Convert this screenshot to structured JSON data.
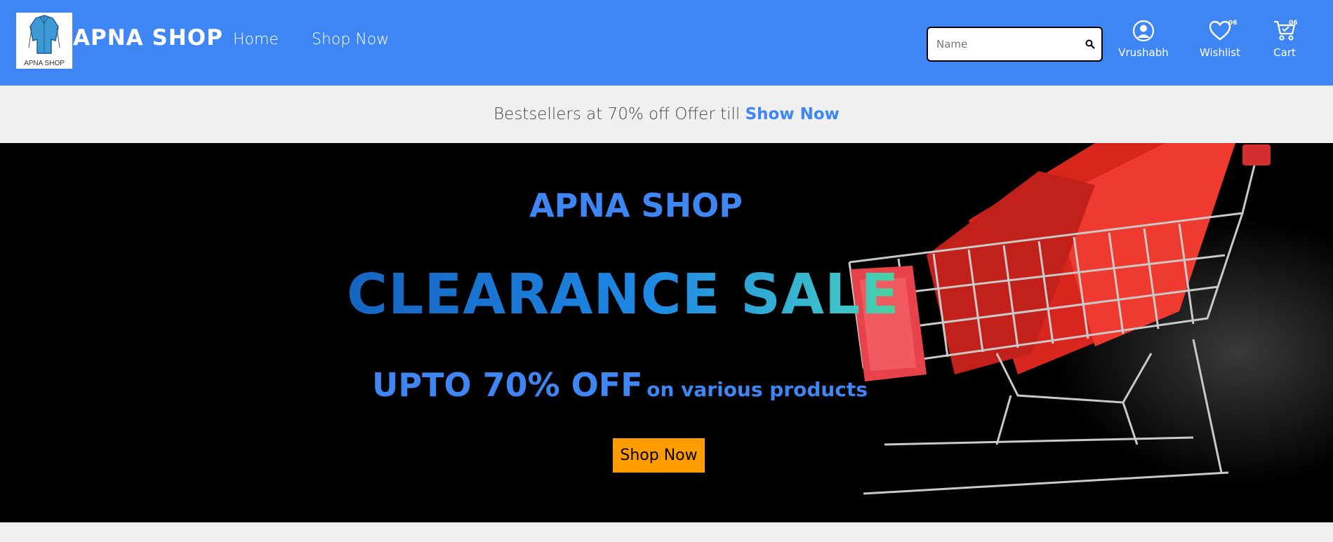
{
  "header": {
    "brand": "APNA SHOP",
    "logo_caption": "APNA SHOP",
    "nav": [
      {
        "label": "Home"
      },
      {
        "label": "Shop Now"
      }
    ],
    "search": {
      "placeholder": "Name",
      "icon": "search-icon"
    },
    "user": {
      "label": "Vrushabh",
      "icon": "user-circle-icon"
    },
    "wishlist": {
      "label": "Wishlist",
      "count": "06",
      "icon": "heart-icon"
    },
    "cart": {
      "label": "Cart",
      "count": "06",
      "icon": "cart-icon"
    },
    "color": "#3f86f5"
  },
  "promo": {
    "text": "Bestsellers at 70% off Offer till ",
    "link": "Show Now",
    "link_color": "#3f86f5"
  },
  "hero": {
    "brand": "APNA SHOP",
    "title": "CLEARANCE SALE",
    "offer_big": "UPTO 70% OFF",
    "offer_small": "on various products",
    "button": "Shop Now",
    "button_color": "#ff9c00",
    "image": "shopping-cart-with-red-bags"
  }
}
